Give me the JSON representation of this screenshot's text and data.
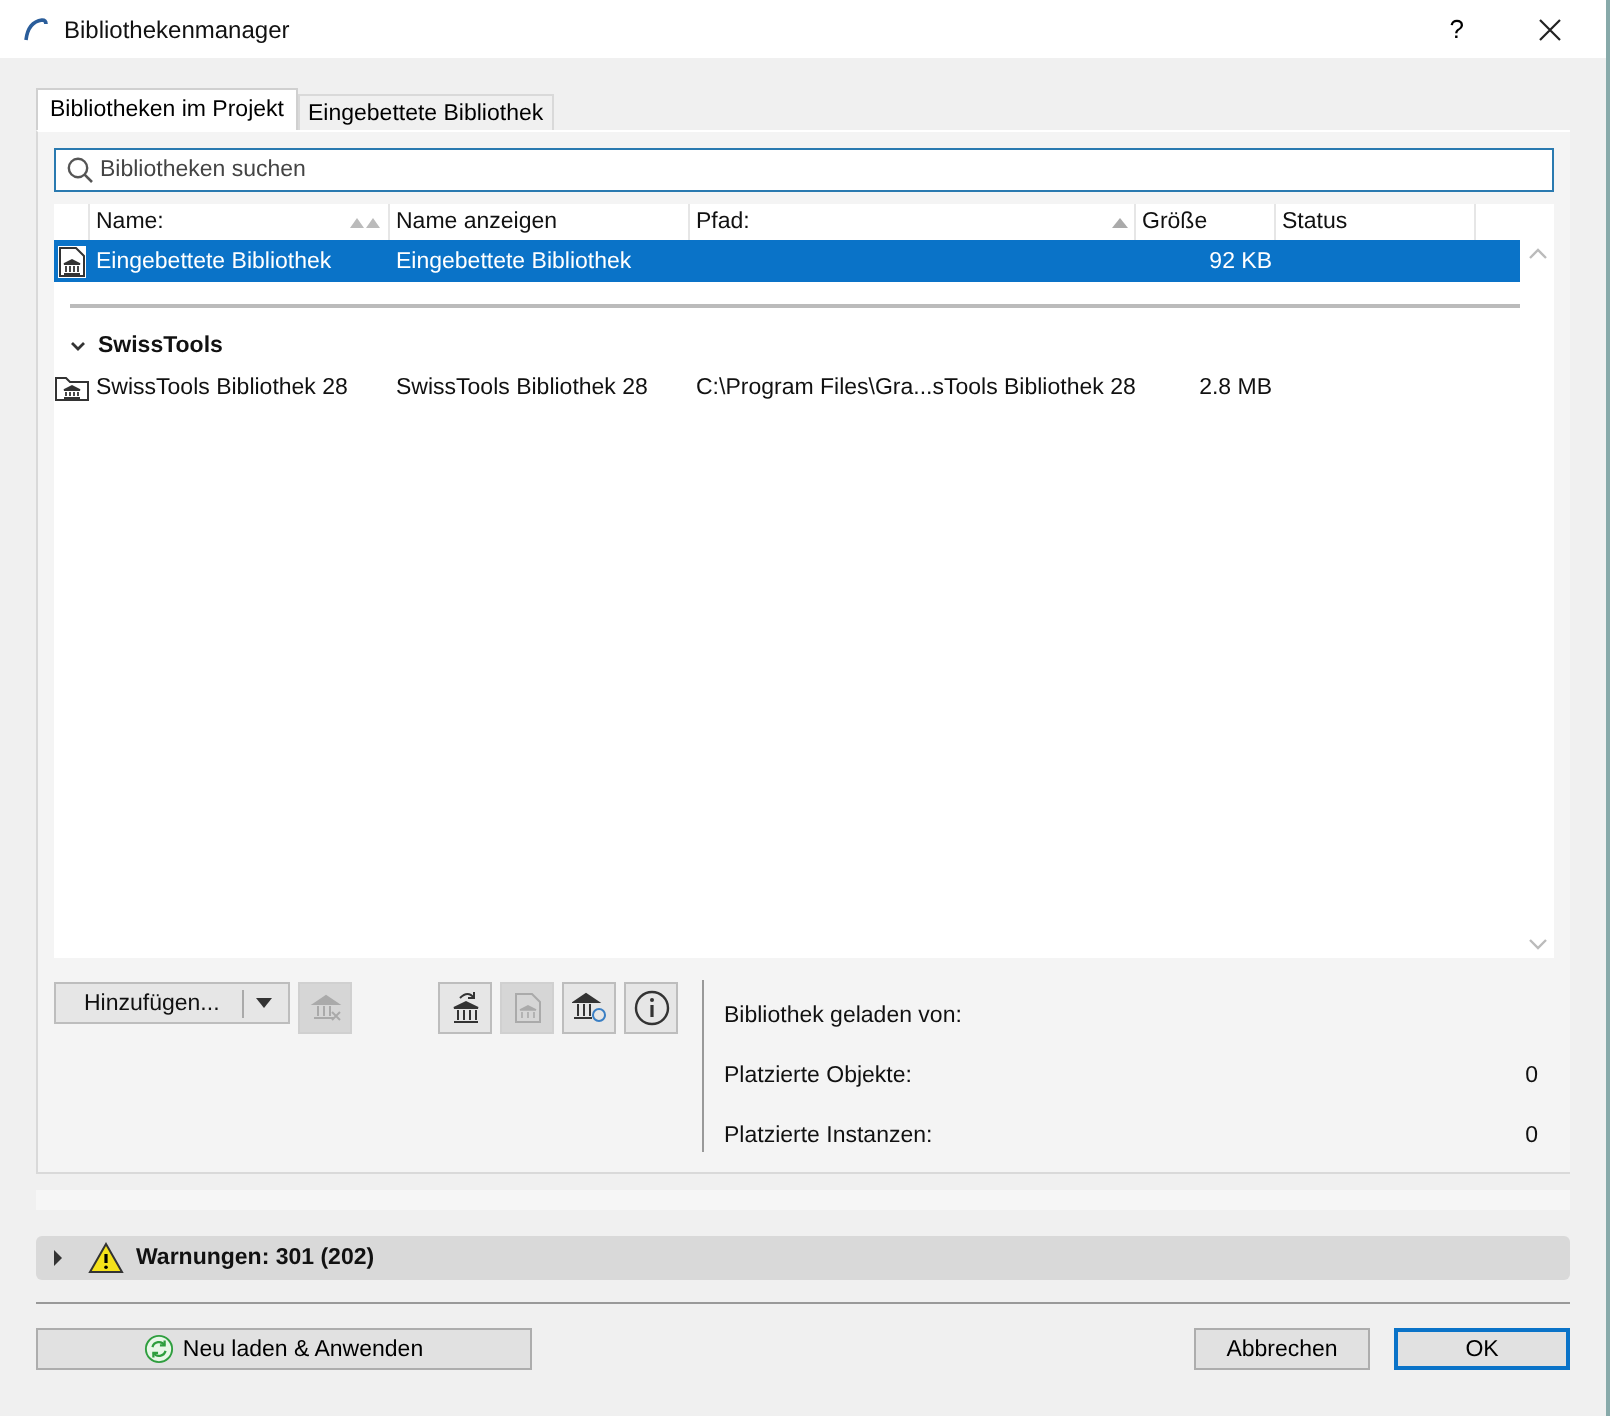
{
  "window": {
    "title": "Bibliothekenmanager",
    "help": "?"
  },
  "tabs": [
    {
      "label": "Bibliotheken im Projekt",
      "selected": true
    },
    {
      "label": "Eingebettete Bibliothek",
      "selected": false
    }
  ],
  "search": {
    "placeholder": "Bibliotheken suchen"
  },
  "table": {
    "columns": [
      {
        "label": "Name:",
        "sortable": true,
        "sorted": false
      },
      {
        "label": "Name anzeigen"
      },
      {
        "label": "Pfad:",
        "sortable": true,
        "sorted": true
      },
      {
        "label": "Größe"
      },
      {
        "label": "Status"
      }
    ],
    "sections": [
      {
        "rows": [
          {
            "kind": "embedded",
            "selected": true,
            "name": "Eingebettete Bibliothek",
            "display_name": "Eingebettete Bibliothek",
            "size": "92 KB"
          }
        ]
      },
      {
        "title": "SwissTools",
        "expanded": true,
        "rows": [
          {
            "kind": "folder",
            "selected": false,
            "name": "SwissTools Bibliothek 28",
            "display_name": "SwissTools Bibliothek 28",
            "path": "C:\\Program Files\\Gra...sTools Bibliothek 28",
            "size": "2.8 MB"
          }
        ]
      }
    ]
  },
  "add_button": {
    "label": "Hinzufügen..."
  },
  "remove_button": {
    "disabled": true
  },
  "tool_buttons": [
    {
      "kind": "library-arrow",
      "disabled": false
    },
    {
      "kind": "document",
      "disabled": true
    },
    {
      "kind": "library-refresh",
      "disabled": false
    },
    {
      "kind": "info",
      "disabled": false
    }
  ],
  "info": [
    {
      "label": "Bibliothek geladen von:"
    },
    {
      "label": "Platzierte Objekte:",
      "value": "0"
    },
    {
      "label": "Platzierte Instanzen:",
      "value": "0"
    }
  ],
  "warnings": {
    "text": "Warnungen: 301 (202)",
    "expanded": false
  },
  "footer": {
    "reload": "Neu laden & Anwenden",
    "cancel": "Abbrechen",
    "ok": "OK"
  }
}
